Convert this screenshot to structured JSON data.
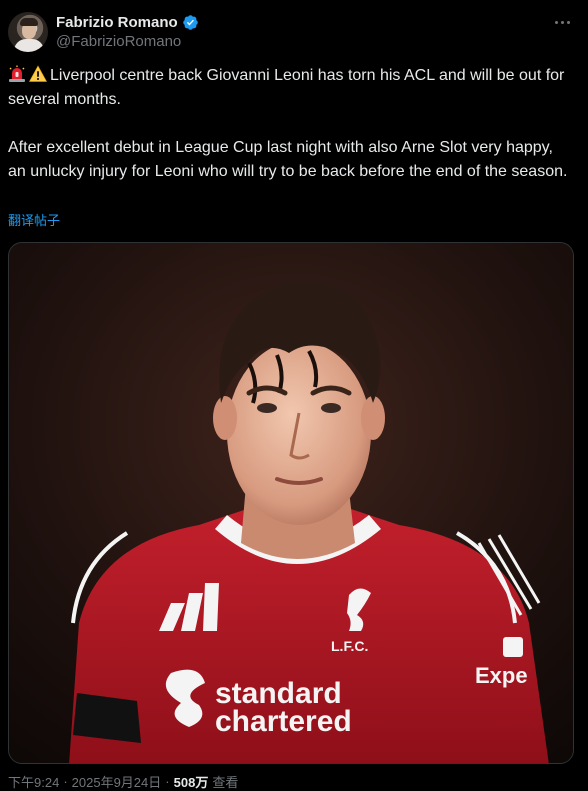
{
  "author": {
    "display_name": "Fabrizio Romano",
    "handle": "@FabrizioRomano",
    "verified": true
  },
  "tweet": {
    "emojis": [
      "siren-icon",
      "warning-icon"
    ],
    "paragraph_1": "Liverpool centre back Giovanni Leoni has torn his ACL and will be out for several months.",
    "paragraph_2": "After excellent debut in League Cup last night with also Arne Slot very happy, an unlucky injury for Leoni who will try to be back before the end of the season.",
    "translate_label": "翻译帖子"
  },
  "photo": {
    "kit_sponsor": "standard chartered",
    "kit_sponsor_line1": "standard",
    "kit_sponsor_line2": "chartered",
    "club_crest_text": "L.F.C.",
    "sleeve_text": "Expe"
  },
  "meta": {
    "time": "下午9:24",
    "separator_1": "·",
    "date": "2025年9月24日",
    "separator_2": "·",
    "views_count": "508万",
    "views_label": "查看"
  },
  "colors": {
    "background": "#000000",
    "text": "#e7e9ea",
    "secondary": "#71767b",
    "link": "#1d9bf0",
    "kit_red": "#b3121f"
  }
}
